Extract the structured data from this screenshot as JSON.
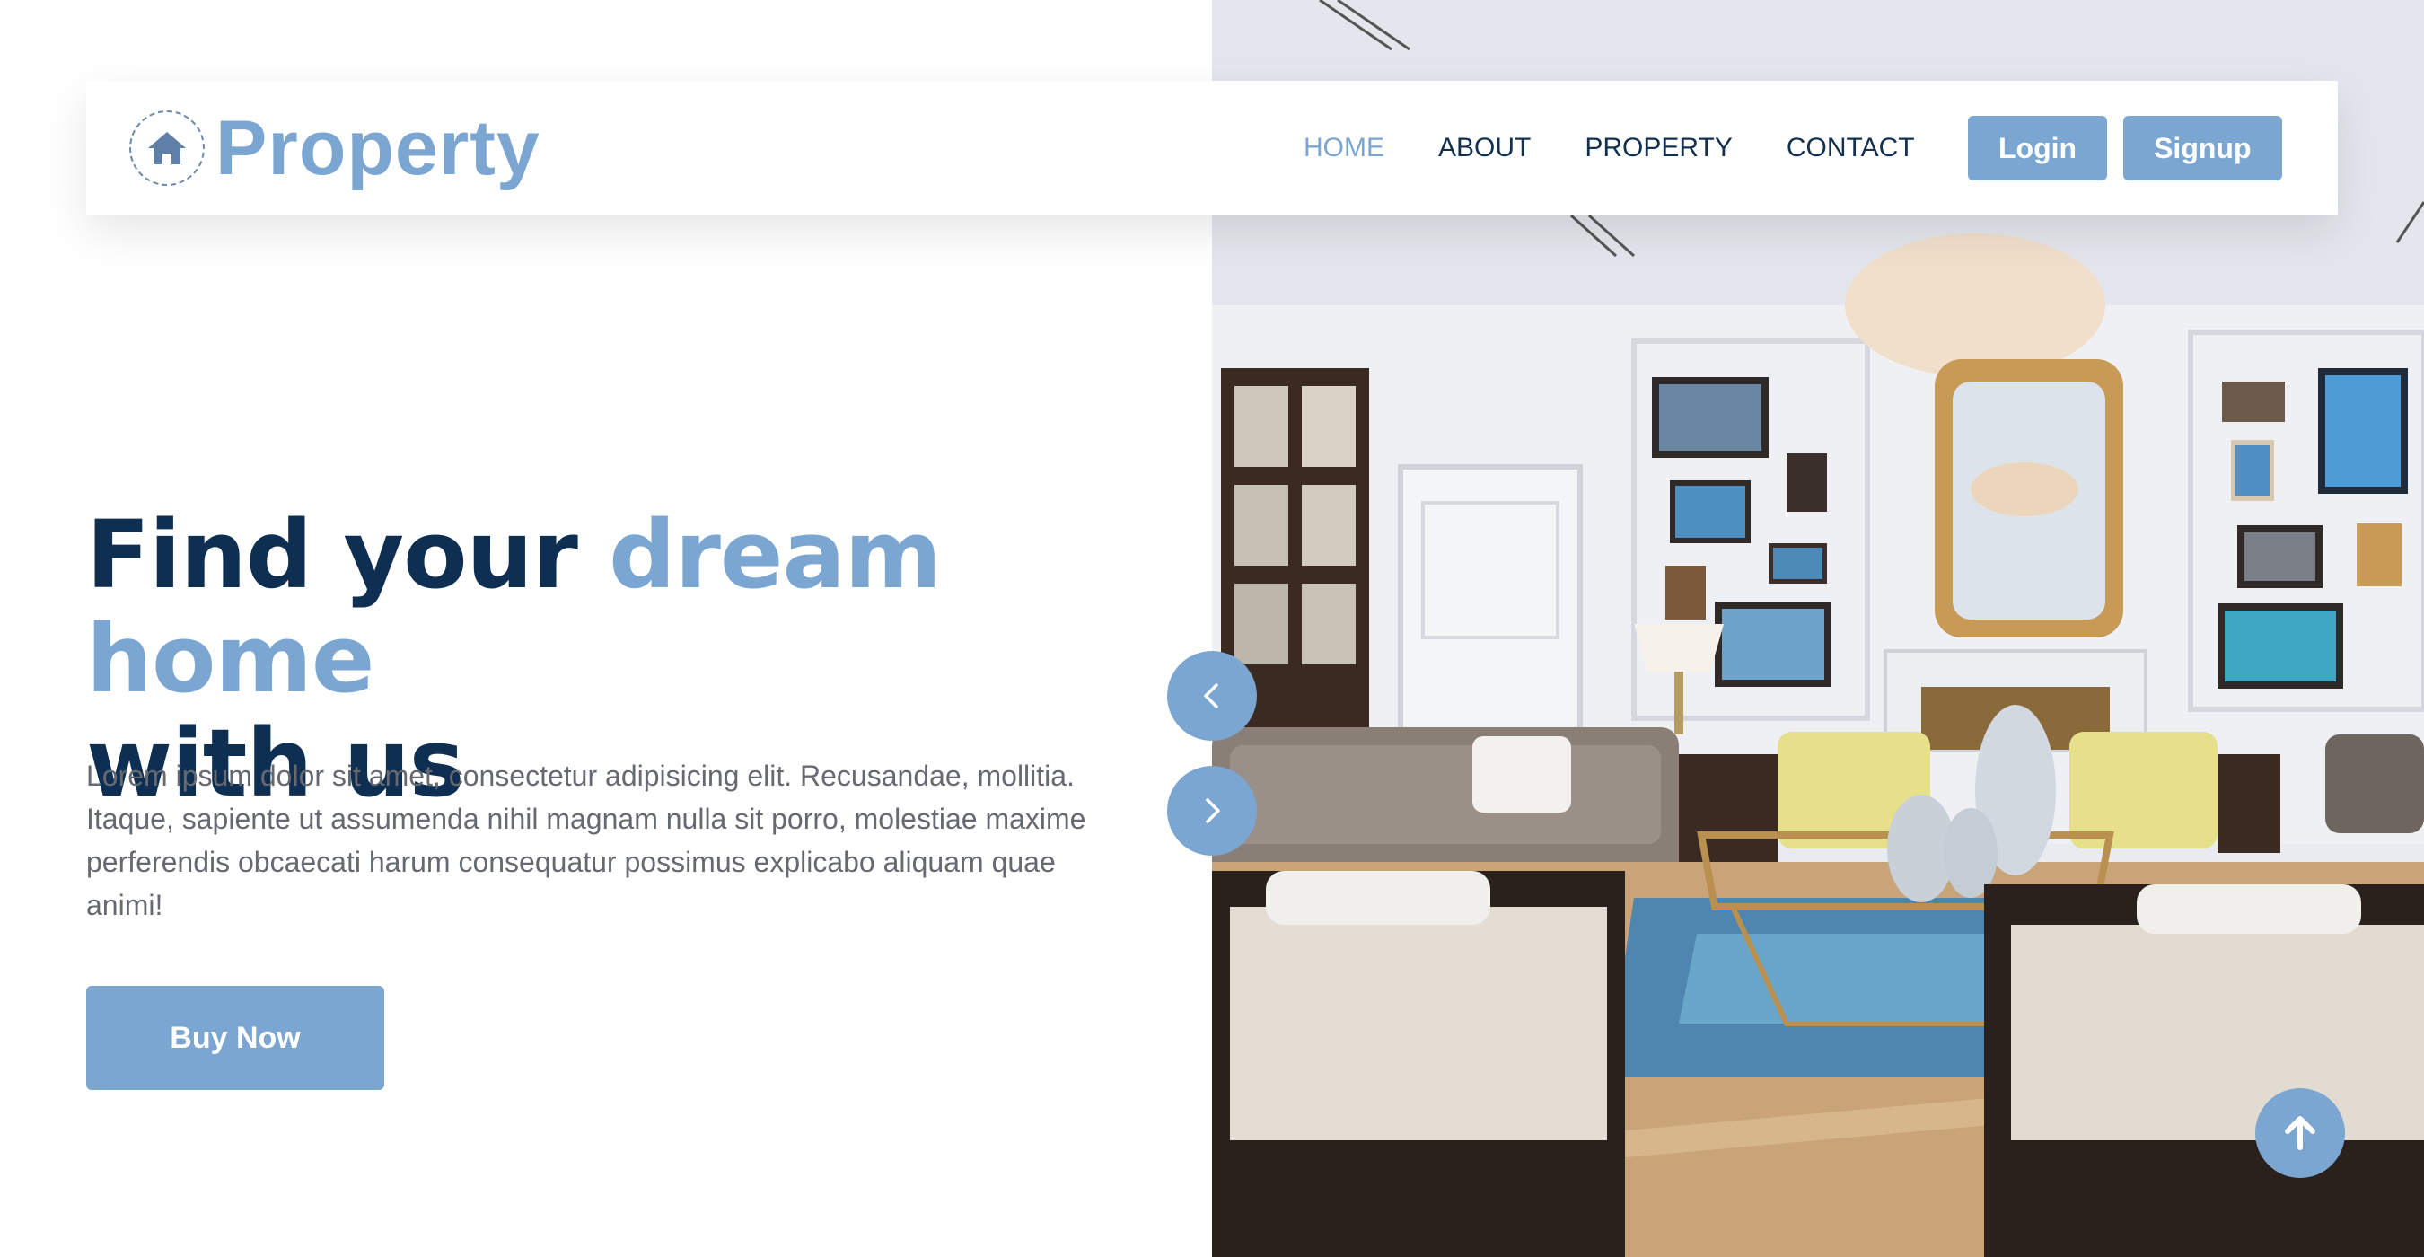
{
  "brand": {
    "name": "Property",
    "logo_icon": "home-icon"
  },
  "nav": {
    "items": [
      "HOME",
      "ABOUT",
      "PROPERTY",
      "CONTACT"
    ],
    "active": "HOME"
  },
  "auth": {
    "login_label": "Login",
    "signup_label": "Signup"
  },
  "hero": {
    "title_part1": "Find your ",
    "title_accent": "dream home",
    "title_part2": "with us",
    "description": "Lorem ipsum dolor sit amet, consectetur adipisicing elit. Recusandae, mollitia. Itaque, sapiente ut assumenda nihil magnam nulla sit porro, molestiae maxime perferendis obcaecati harum consequatur possimus explicabo aliquam quae animi!",
    "cta_label": "Buy Now",
    "image": "living-room-photo"
  },
  "slider": {
    "prev_icon": "chevron-left-icon",
    "next_icon": "chevron-right-icon"
  },
  "scroll_top_icon": "arrow-up-icon",
  "colors": {
    "accent": "#7aa6d1",
    "heading": "#0f2f52",
    "text": "#666a70",
    "nav_text": "#12304f"
  }
}
